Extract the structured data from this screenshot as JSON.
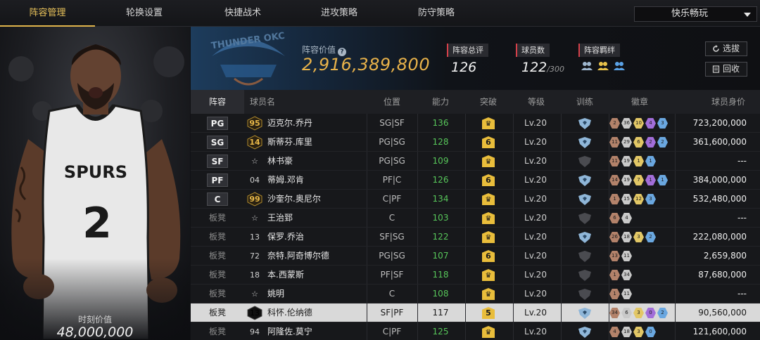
{
  "nav": {
    "tabs": [
      "阵容管理",
      "轮换设置",
      "快捷战术",
      "进攻策略",
      "防守策略"
    ],
    "active_tab": 0,
    "mode_select": "快乐畅玩"
  },
  "portrait": {
    "jersey_team": "SPURS",
    "jersey_number": "2",
    "moment_label": "时刻价值",
    "moment_value": "48,000,000"
  },
  "stats": {
    "team_logo_text": "THUNDER OKC",
    "value_label": "阵容价值",
    "value_number": "2,916,389,800",
    "rating_label": "阵容总评",
    "rating_value": "126",
    "players_label": "球员数",
    "players_value": "122",
    "players_max": "/300",
    "bond_label": "阵容羁绊",
    "scout_button": "选拔",
    "recycle_button": "回收"
  },
  "table": {
    "headers": [
      "阵容",
      "球员名",
      "位置",
      "能力",
      "突破",
      "等级",
      "训练",
      "徽章",
      "球员身价"
    ],
    "rows": [
      {
        "slot": "PG",
        "starter": true,
        "num": "95",
        "numStyle": "gold",
        "name": "迈克尔.乔丹",
        "pos": "SG|SF",
        "ability": "136",
        "breakthrough": "crown",
        "level": "Lv.20",
        "train": true,
        "badges": [
          [
            "c1",
            "2"
          ],
          [
            "c2",
            "36"
          ],
          [
            "c3",
            "10"
          ],
          [
            "c4",
            "4"
          ],
          [
            "c5",
            "3"
          ]
        ],
        "price": "723,200,000"
      },
      {
        "slot": "SG",
        "starter": true,
        "num": "14",
        "numStyle": "gold",
        "name": "斯蒂芬.库里",
        "pos": "PG|SG",
        "ability": "128",
        "breakthrough": "6",
        "level": "Lv.20",
        "train": true,
        "badges": [
          [
            "c1",
            "11"
          ],
          [
            "c2",
            "29"
          ],
          [
            "c3",
            "6"
          ],
          [
            "c4",
            "2"
          ],
          [
            "c5",
            "2"
          ]
        ],
        "price": "361,600,000"
      },
      {
        "slot": "SF",
        "starter": true,
        "num": "☆",
        "numStyle": "star",
        "name": "林书豪",
        "pos": "PG|SG",
        "ability": "109",
        "breakthrough": "crown",
        "level": "Lv.20",
        "train": false,
        "badges": [
          [
            "c1",
            "11"
          ],
          [
            "c2",
            "19"
          ],
          [
            "c3",
            "1"
          ],
          [
            "c5",
            "1"
          ]
        ],
        "price": "---"
      },
      {
        "slot": "PF",
        "starter": true,
        "num": "04",
        "numStyle": "plain",
        "name": "蒂姆.邓肯",
        "pos": "PF|C",
        "ability": "126",
        "breakthrough": "6",
        "level": "Lv.20",
        "train": true,
        "badges": [
          [
            "c1",
            "14"
          ],
          [
            "c2",
            "19"
          ],
          [
            "c3",
            "7"
          ],
          [
            "c4",
            "1"
          ],
          [
            "c5",
            "1"
          ]
        ],
        "price": "384,000,000"
      },
      {
        "slot": "C",
        "starter": true,
        "num": "99",
        "numStyle": "gold",
        "name": "沙奎尔.奥尼尔",
        "pos": "C|PF",
        "ability": "134",
        "breakthrough": "crown",
        "level": "Lv.20",
        "train": true,
        "badges": [
          [
            "c1",
            "1"
          ],
          [
            "c2",
            "15"
          ],
          [
            "c3",
            "12"
          ],
          [
            "c5",
            "3"
          ]
        ],
        "price": "532,480,000"
      },
      {
        "slot": "板凳",
        "starter": false,
        "num": "☆",
        "numStyle": "star",
        "name": "王治郅",
        "pos": "C",
        "ability": "103",
        "breakthrough": "crown",
        "level": "Lv.20",
        "train": false,
        "badges": [
          [
            "c1",
            "6"
          ],
          [
            "c2",
            "4"
          ]
        ],
        "price": "---"
      },
      {
        "slot": "板凳",
        "starter": false,
        "num": "13",
        "numStyle": "plain",
        "name": "保罗.乔治",
        "pos": "SF|SG",
        "ability": "122",
        "breakthrough": "crown",
        "level": "Lv.20",
        "train": true,
        "badges": [
          [
            "c1",
            "26"
          ],
          [
            "c2",
            "18"
          ],
          [
            "c3",
            "3"
          ],
          [
            "c5",
            "2"
          ]
        ],
        "price": "222,080,000"
      },
      {
        "slot": "板凳",
        "starter": false,
        "num": "72",
        "numStyle": "plain",
        "name": "奈特.阿奇博尔德",
        "pos": "PG|SG",
        "ability": "107",
        "breakthrough": "6",
        "level": "Lv.20",
        "train": false,
        "badges": [
          [
            "c1",
            "13"
          ],
          [
            "c2",
            "11"
          ]
        ],
        "price": "2,659,800"
      },
      {
        "slot": "板凳",
        "starter": false,
        "num": "18",
        "numStyle": "plain",
        "name": "本.西蒙斯",
        "pos": "PF|SF",
        "ability": "118",
        "breakthrough": "crown",
        "level": "Lv.20",
        "train": false,
        "badges": [
          [
            "c1",
            "1"
          ],
          [
            "c2",
            "34"
          ]
        ],
        "price": "87,680,000"
      },
      {
        "slot": "板凳",
        "starter": false,
        "num": "☆",
        "numStyle": "star",
        "name": "姚明",
        "pos": "C",
        "ability": "108",
        "breakthrough": "crown",
        "level": "Lv.20",
        "train": false,
        "badges": [
          [
            "c1",
            "1"
          ],
          [
            "c2",
            "11"
          ]
        ],
        "price": "---"
      },
      {
        "slot": "板凳",
        "starter": false,
        "num": "13",
        "numStyle": "dark",
        "name": "科怀.伦纳德",
        "pos": "SF|PF",
        "ability": "117",
        "breakthrough": "5",
        "level": "Lv.20",
        "train": true,
        "badges": [
          [
            "c1",
            "34"
          ],
          [
            "c2",
            "6"
          ],
          [
            "c3",
            "3"
          ],
          [
            "c4",
            "0"
          ],
          [
            "c5",
            "2"
          ]
        ],
        "price": "90,560,000",
        "selected": true
      },
      {
        "slot": "板凳",
        "starter": false,
        "num": "94",
        "numStyle": "plain",
        "name": "阿隆佐.莫宁",
        "pos": "C|PF",
        "ability": "125",
        "breakthrough": "crown",
        "level": "Lv.20",
        "train": true,
        "badges": [
          [
            "c1",
            "4"
          ],
          [
            "c2",
            "18"
          ],
          [
            "c3",
            "3"
          ],
          [
            "c5",
            "0"
          ]
        ],
        "price": "121,600,000"
      }
    ]
  },
  "colors": {
    "accent_gold": "#e8b24a",
    "ability_green": "#57c65a",
    "stat_marker_red": "#d6404a"
  }
}
